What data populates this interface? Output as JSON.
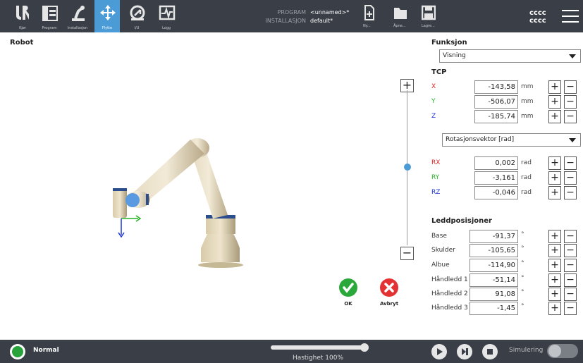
{
  "nav": {
    "items": [
      {
        "label": "Kjør",
        "icon": "ur-logo-icon"
      },
      {
        "label": "Program",
        "icon": "program-icon"
      },
      {
        "label": "Installasjon",
        "icon": "installation-icon"
      },
      {
        "label": "Flytte",
        "icon": "move-icon"
      },
      {
        "label": "I/U",
        "icon": "io-icon"
      },
      {
        "label": "Logg",
        "icon": "log-icon"
      }
    ],
    "active": "Flytte"
  },
  "program": {
    "program_label": "PROGRAM",
    "installation_label": "INSTALLASJON",
    "program_name": "<unnamed>*",
    "installation_name": "default*"
  },
  "file": {
    "new_label": "Ny...",
    "open_label": "Åpne...",
    "save_label": "Lagre..."
  },
  "user": {
    "line1": "cccc",
    "line2": "cccc"
  },
  "robot_title": "Robot",
  "actions": {
    "ok_label": "OK",
    "cancel_label": "Avbryt"
  },
  "panel": {
    "function_title": "Funksjon",
    "function_value": "Visning",
    "tcp_title": "TCP",
    "tcp": [
      {
        "label": "X",
        "value": "-143,58",
        "unit": "mm",
        "color": "#e02020"
      },
      {
        "label": "Y",
        "value": "-506,07",
        "unit": "mm",
        "color": "#23b423"
      },
      {
        "label": "Z",
        "value": "-185,74",
        "unit": "mm",
        "color": "#1a35d8"
      }
    ],
    "rotation_value": "Rotasjonsvektor [rad]",
    "rot": [
      {
        "label": "RX",
        "value": "0,002",
        "unit": "rad",
        "color": "#e02020"
      },
      {
        "label": "RY",
        "value": "-3,161",
        "unit": "rad",
        "color": "#23b423"
      },
      {
        "label": "RZ",
        "value": "-0,046",
        "unit": "rad",
        "color": "#1a35d8"
      }
    ],
    "joints_title": "Leddposisjoner",
    "joints": [
      {
        "label": "Base",
        "value": "-91,37",
        "unit": "°"
      },
      {
        "label": "Skulder",
        "value": "-105,65",
        "unit": "°"
      },
      {
        "label": "Albue",
        "value": "-114,90",
        "unit": "°"
      },
      {
        "label": "Håndledd 1",
        "value": "-51,14",
        "unit": "°"
      },
      {
        "label": "Håndledd 2",
        "value": "91,08",
        "unit": "°"
      },
      {
        "label": "Håndledd 3",
        "value": "-1,45",
        "unit": "°"
      }
    ]
  },
  "status": {
    "text": "Normal",
    "color": "#27a33a"
  },
  "speed": {
    "label": "Hastighet 100%",
    "value": 1.0
  },
  "simulation": {
    "label": "Simulering",
    "enabled": false
  },
  "colors": {
    "topbar": "#3a3f47",
    "accent": "#4b9bd6",
    "ok": "#2aa83a",
    "cancel": "#e23232"
  }
}
